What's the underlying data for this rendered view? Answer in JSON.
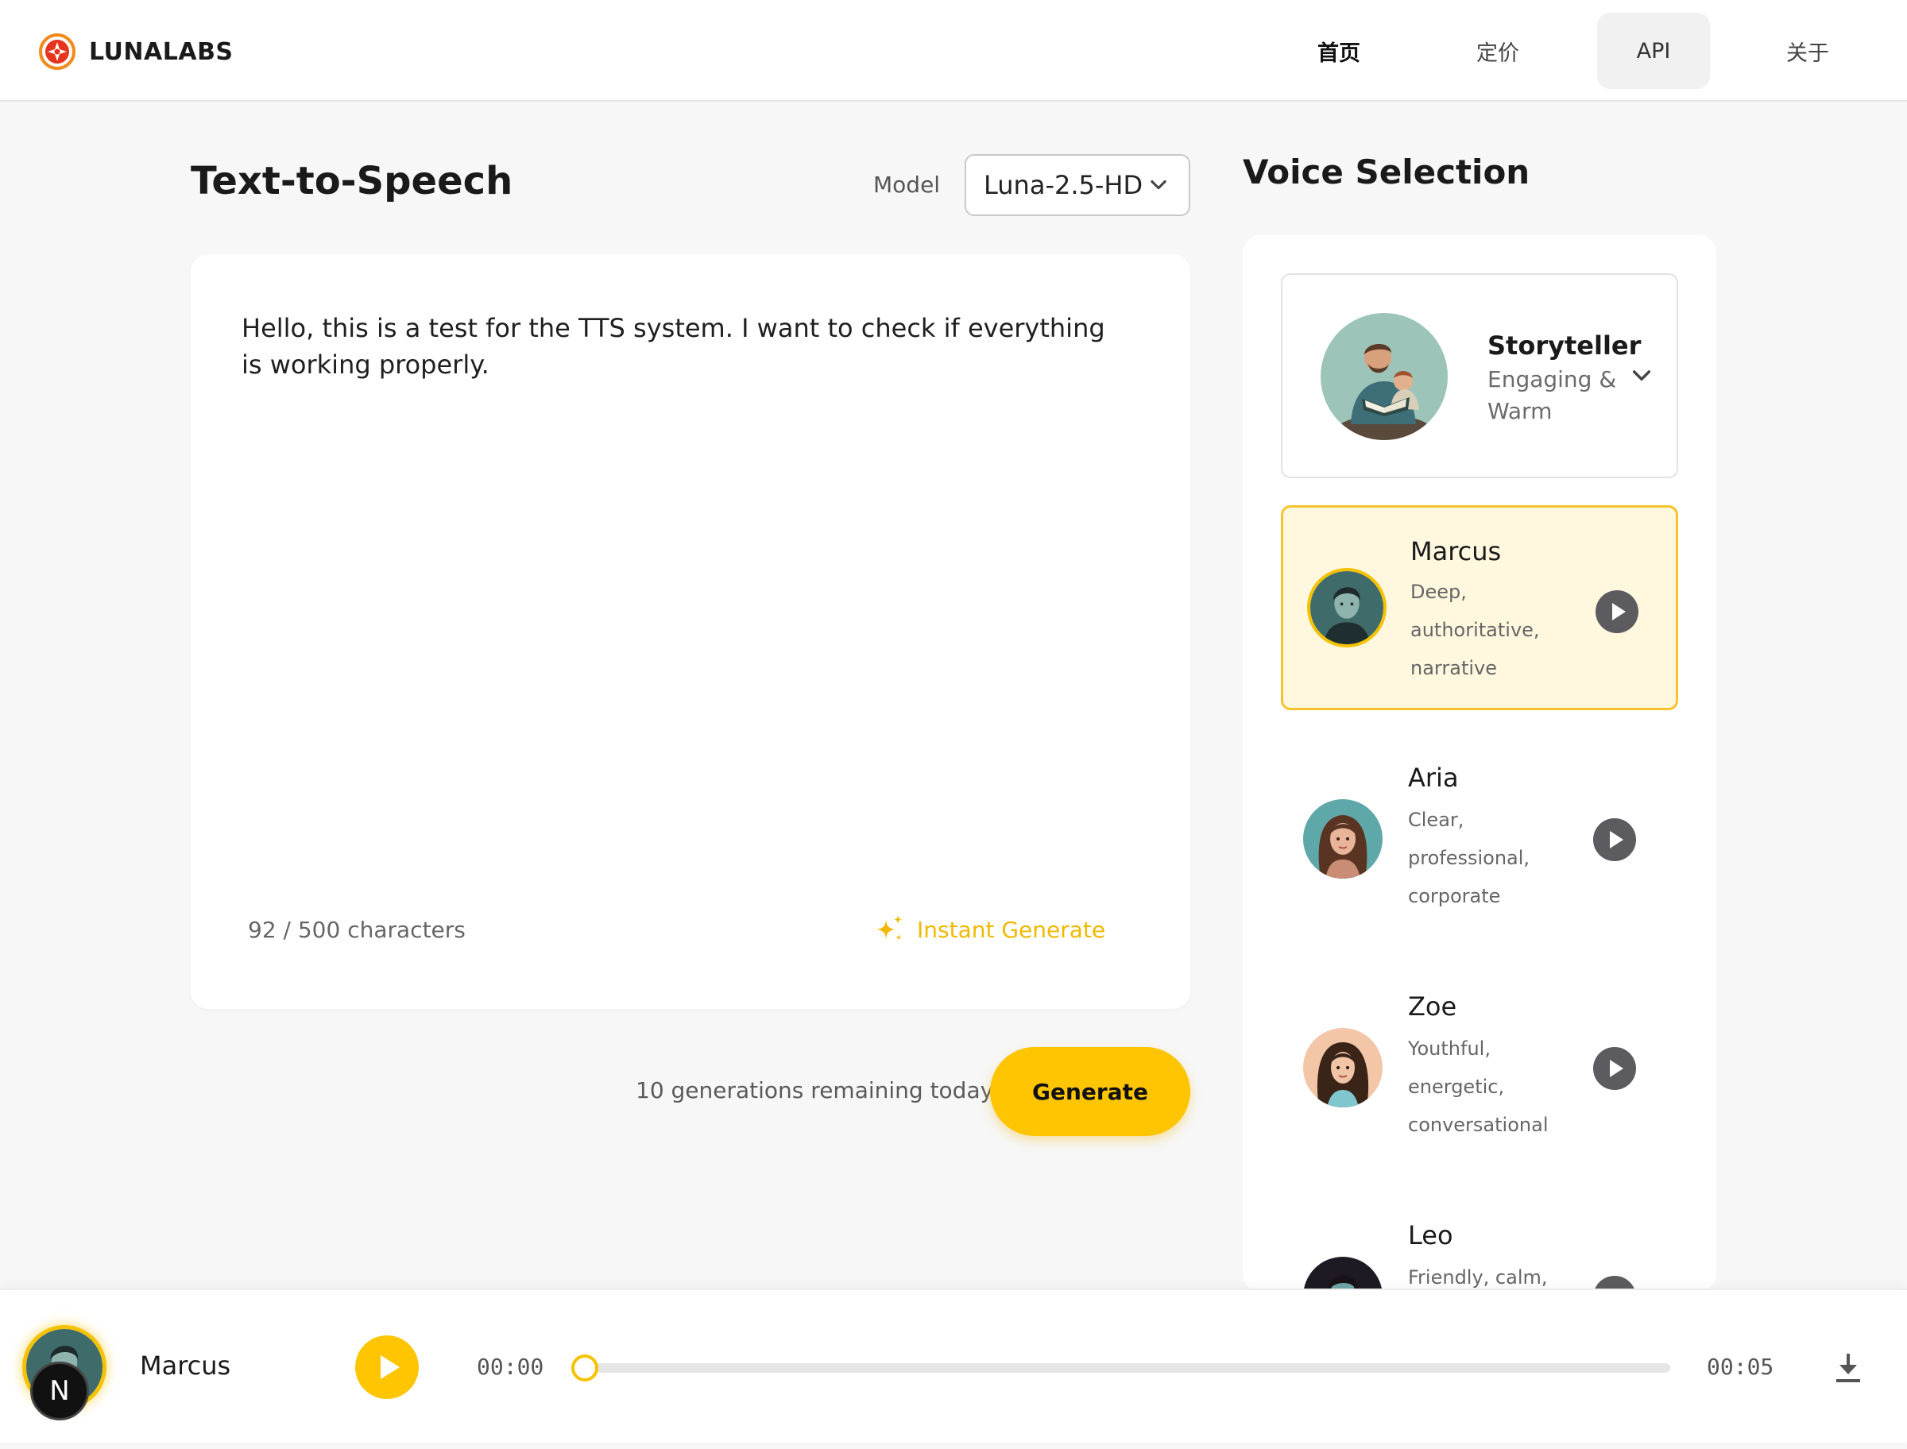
{
  "header": {
    "brand": "LUNALABS",
    "nav": [
      {
        "label": "首页"
      },
      {
        "label": "定价"
      },
      {
        "label": "API"
      },
      {
        "label": "关于"
      }
    ]
  },
  "tts": {
    "title": "Text-to-Speech",
    "model_label": "Model",
    "model_value": "Luna-2.5-HD",
    "text": "Hello, this is a test for the TTS system. I want to check if everything is working properly.",
    "char_count": "92 / 500 characters",
    "instant_generate": "Instant Generate",
    "remaining": "10 generations remaining today",
    "generate": "Generate"
  },
  "voice": {
    "title": "Voice Selection",
    "category": {
      "name": "Storyteller",
      "desc": "Engaging & Warm"
    },
    "voices": [
      {
        "name": "Marcus",
        "desc": "Deep, authoritative, narrative",
        "selected": true
      },
      {
        "name": "Aria",
        "desc": "Clear, professional, corporate",
        "selected": false
      },
      {
        "name": "Zoe",
        "desc": "Youthful, energetic, conversational",
        "selected": false
      },
      {
        "name": "Leo",
        "desc": "Friendly, calm,",
        "selected": false
      }
    ]
  },
  "player": {
    "voice_name": "Marcus",
    "badge": "N",
    "current_time": "00:00",
    "total_time": "00:05",
    "progress": 0
  },
  "colors": {
    "accent": "#fec500",
    "accent_text": "#f2b800",
    "selected_bg": "#fff8df"
  }
}
